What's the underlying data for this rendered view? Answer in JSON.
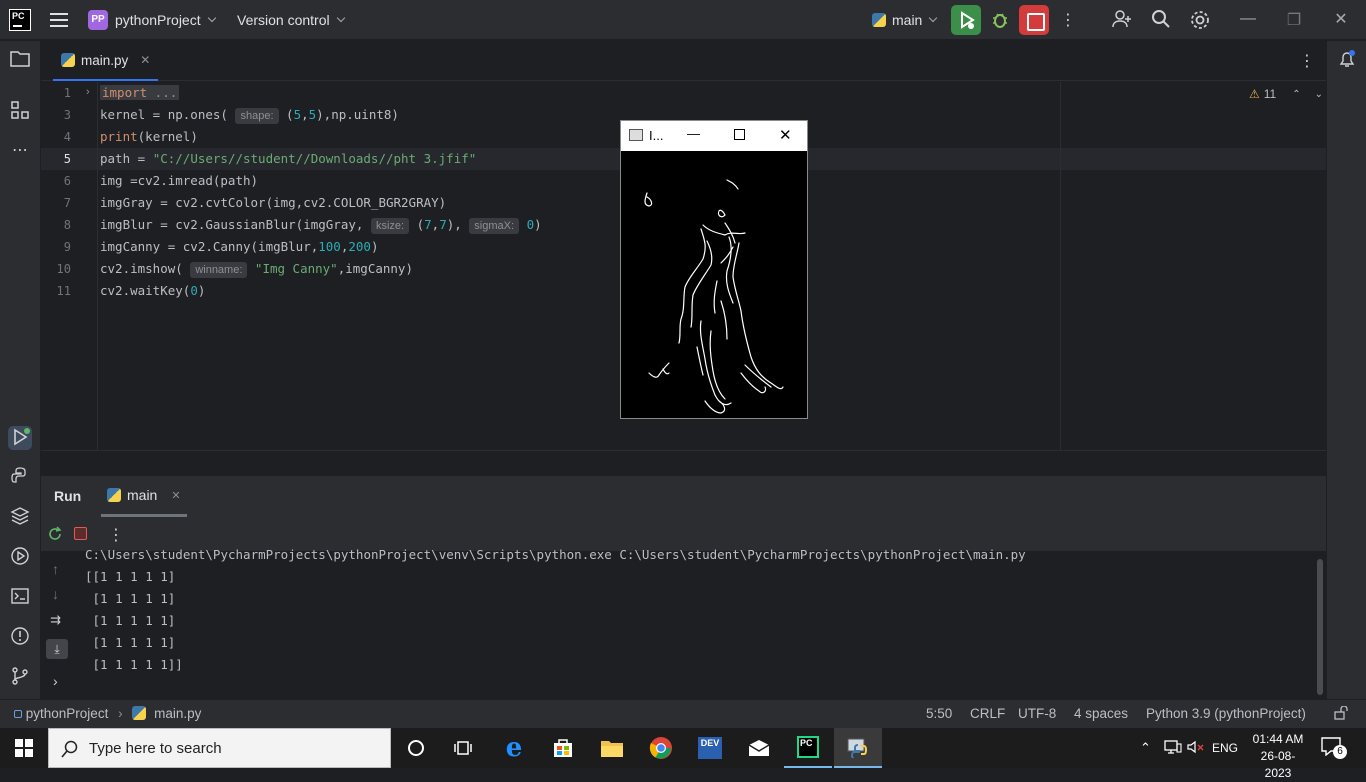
{
  "titlebar": {
    "logo": "PC",
    "project_badge": "PP",
    "project_name": "pythonProject",
    "vcs_label": "Version control",
    "run_config": "main"
  },
  "editor": {
    "tab_label": "main.py",
    "line_numbers": [
      "1",
      "3",
      "4",
      "5",
      "6",
      "7",
      "8",
      "9",
      "10",
      "11"
    ],
    "warnings_count": "11",
    "hints": {
      "shape": "shape:",
      "ksize": "ksize:",
      "sigmaX": "sigmaX:",
      "winname": "winname:"
    }
  },
  "cv_window": {
    "title": "I..."
  },
  "run_panel": {
    "tab_run": "Run",
    "tab_main": "main",
    "console_lines": [
      "C:\\Users\\student\\PycharmProjects\\pythonProject\\venv\\Scripts\\python.exe C:\\Users\\student\\PycharmProjects\\pythonProject\\main.py",
      "[[1 1 1 1 1]",
      " [1 1 1 1 1]",
      " [1 1 1 1 1]",
      " [1 1 1 1 1]",
      " [1 1 1 1 1]]"
    ]
  },
  "statusbar": {
    "breadcrumb_project": "pythonProject",
    "breadcrumb_file": "main.py",
    "position": "5:50",
    "line_ending": "CRLF",
    "encoding": "UTF-8",
    "indent": "4 spaces",
    "interpreter": "Python 3.9 (pythonProject)"
  },
  "taskbar": {
    "search_placeholder": "Type here to search",
    "language": "ENG",
    "time": "01:44 AM",
    "date": "26-08-2023",
    "notifications": "6",
    "dev_label": "DEV",
    "pc_label": "PC"
  },
  "colors": {
    "accent": "#3574f0",
    "run_green": "#3b8f4a",
    "stop_red": "#d43b3b",
    "project_badge": "#a068e0"
  }
}
